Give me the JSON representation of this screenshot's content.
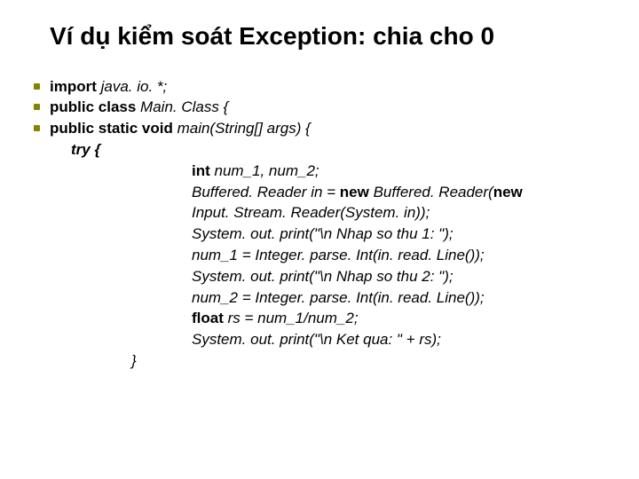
{
  "slide": {
    "title": "Ví dụ kiểm soát Exception: chia cho 0"
  },
  "code": {
    "l1_kw": "import",
    "l1_rest": " java. io. *;",
    "l2_kw": "public class",
    "l2_rest": " Main. Class {",
    "l3_kw": "public static void",
    "l3_rest": " main(String[] args) {",
    "l4": "try {",
    "l5_kw": "int",
    "l5_rest": " num_1, num_2;",
    "l6a": "Buffered. Reader in = ",
    "l6_kw1": "new",
    "l6b": " Buffered. Reader(",
    "l6_kw2": "new",
    "l7": "Input. Stream. Reader(System. in));",
    "l8": "System. out. print(\"\\n Nhap so thu 1: \");",
    "l9": "num_1 = Integer. parse. Int(in. read. Line());",
    "l10": "System. out. print(\"\\n Nhap so thu 2: \");",
    "l11": "num_2 = Integer. parse. Int(in. read. Line());",
    "l12_kw": "float",
    "l12_rest": " rs = num_1/num_2;",
    "l13": "System. out. print(\"\\n Ket qua: \" + rs);",
    "l14": "}"
  }
}
